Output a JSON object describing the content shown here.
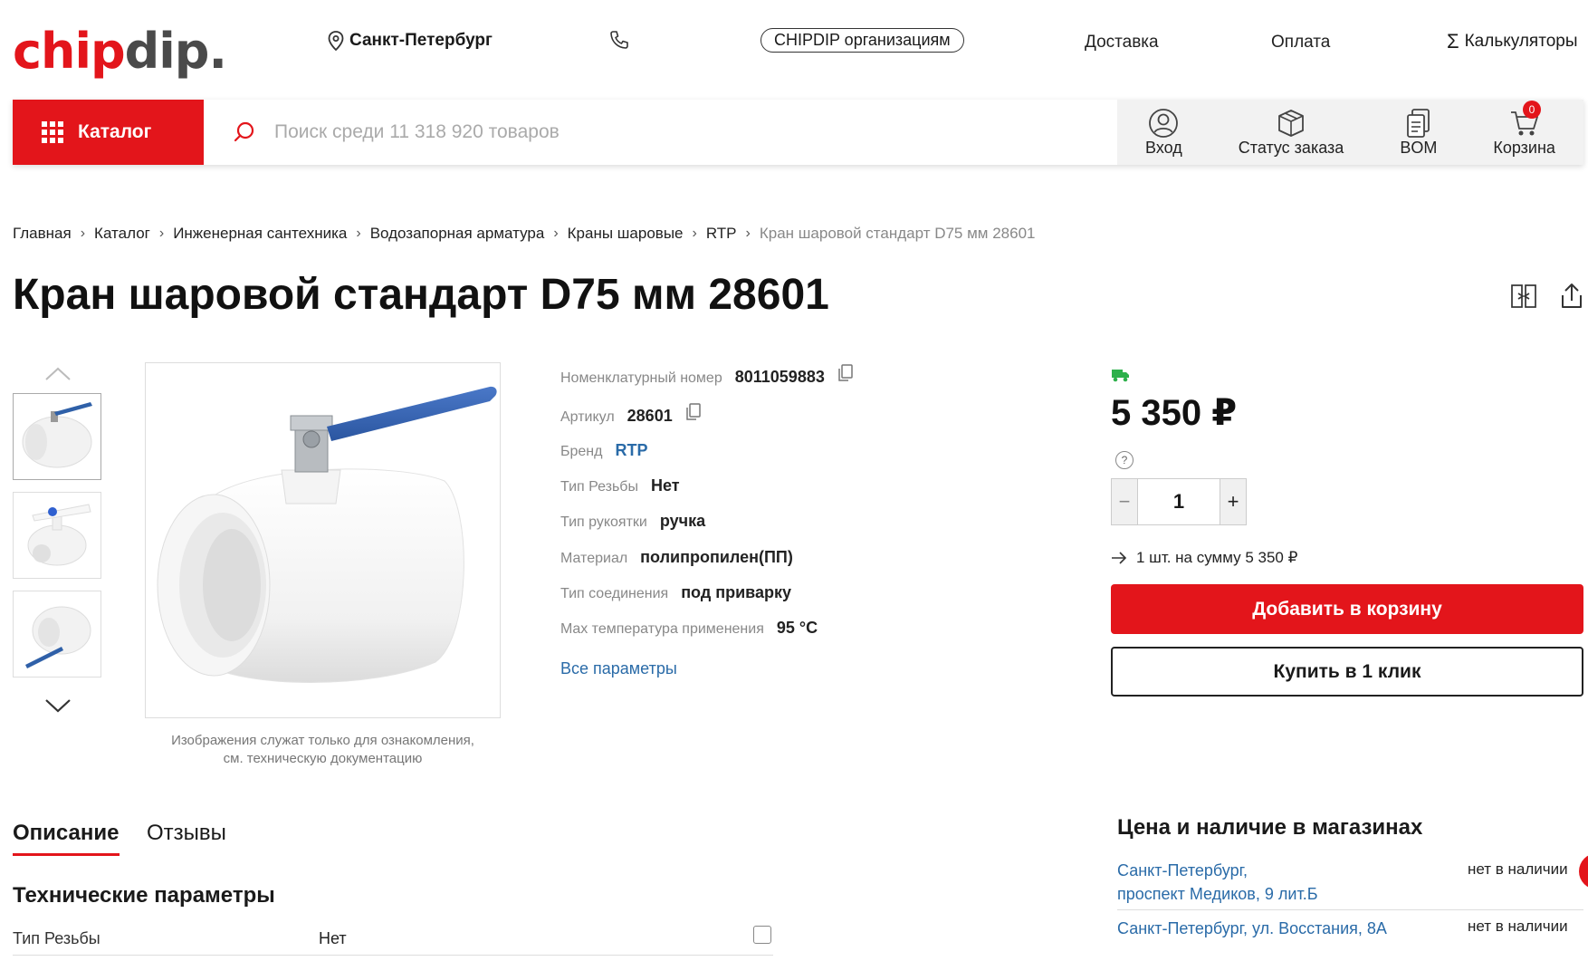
{
  "header": {
    "logo": {
      "chip": "chip",
      "dip": "dip."
    },
    "city": "Санкт-Петербург",
    "orgs_label": "CHIPDIP организациям",
    "nav": [
      "Доставка",
      "Оплата"
    ],
    "calculators": "Калькуляторы"
  },
  "toolbar": {
    "catalog_label": "Каталог",
    "search_placeholder": "Поиск среди 11 318 920 товаров",
    "user_items": [
      {
        "label": "Вход",
        "icon": "user-icon"
      },
      {
        "label": "Статус заказа",
        "icon": "box-icon"
      },
      {
        "label": "BOM",
        "icon": "bom-icon"
      },
      {
        "label": "Корзина",
        "icon": "cart-icon"
      }
    ],
    "cart_count": "0"
  },
  "breadcrumb": {
    "items": [
      "Главная",
      "Каталог",
      "Инженерная сантехника",
      "Водозапорная арматура",
      "Краны шаровые",
      "RTP"
    ],
    "current": "Кран шаровой стандарт D75 мм 28601",
    "separator": "›"
  },
  "product": {
    "title": "Кран шаровой стандарт D75 мм 28601",
    "image_note_line1": "Изображения служат только для ознакомления,",
    "image_note_line2": "см. техническую документацию",
    "specs": [
      {
        "label": "Номенклатурный номер",
        "value": "8011059883"
      },
      {
        "label": "Артикул",
        "value": "28601"
      },
      {
        "label": "Бренд",
        "value": "RTP"
      },
      {
        "label": "Тип Резьбы",
        "value": "Нет"
      },
      {
        "label": "Тип рукоятки",
        "value": "ручка"
      },
      {
        "label": "Материал",
        "value": "полипропилен(ПП)"
      },
      {
        "label": "Тип соединения",
        "value": "под приварку"
      },
      {
        "label": "Max температура применения",
        "value": "95 °C"
      }
    ],
    "all_params": "Все параметры"
  },
  "purchase": {
    "price": "5 350 ₽",
    "help": "?",
    "quantity": "1",
    "minus": "−",
    "plus": "+",
    "sum_text": "1 шт. на сумму 5 350 ₽",
    "add_to_cart": "Добавить в корзину",
    "buy_one_click": "Купить в 1 клик"
  },
  "tabs": {
    "description": "Описание",
    "reviews": "Отзывы"
  },
  "tech": {
    "title": "Технические параметры",
    "rows": [
      {
        "key": "Тип Резьбы",
        "value": "Нет"
      }
    ]
  },
  "stores": {
    "title": "Цена и наличие в магазинах",
    "list": [
      {
        "line1": "Санкт-Петербург,",
        "line2": "проспект Медиков, 9 лит.Б",
        "status": "нет в наличии"
      },
      {
        "line1": "Санкт-Петербург, ул. Восстания, 8А",
        "line2": "",
        "status": "нет в наличии"
      }
    ]
  },
  "colors": {
    "brand_red": "#e3151b",
    "link_blue": "#2a6ba8",
    "delivery_green": "#2db04b"
  }
}
